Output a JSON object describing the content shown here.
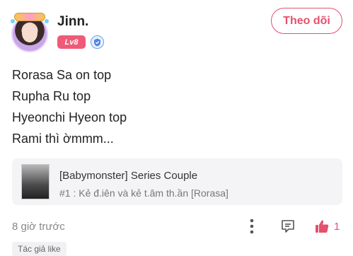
{
  "post": {
    "author": {
      "username": "Jinn.",
      "level": "Lv8"
    },
    "follow_label": "Theo dõi",
    "content_lines": [
      "Rorasa Sa on top",
      "Rupha Ru top",
      "Hyeonchi Hyeon top",
      "Rami thì ờmmm..."
    ],
    "linked_series": {
      "title": "[Babymonster] Series Couple",
      "subtitle": "#1 : Kẻ đ.iên và kẻ t.âm th.ần [Rorasa]"
    },
    "timestamp": "8 giờ trước",
    "like_count": "1",
    "author_like_tag": "Tác giả like"
  },
  "icons": {
    "verified": "verified-shield-icon",
    "more": "more-vertical-icon",
    "comment": "comment-icon",
    "like": "thumbs-up-icon"
  },
  "colors": {
    "accent": "#e4506e",
    "level_badge": "#ef5a78",
    "card_background": "#f4f4f6",
    "muted_text": "#888888"
  }
}
